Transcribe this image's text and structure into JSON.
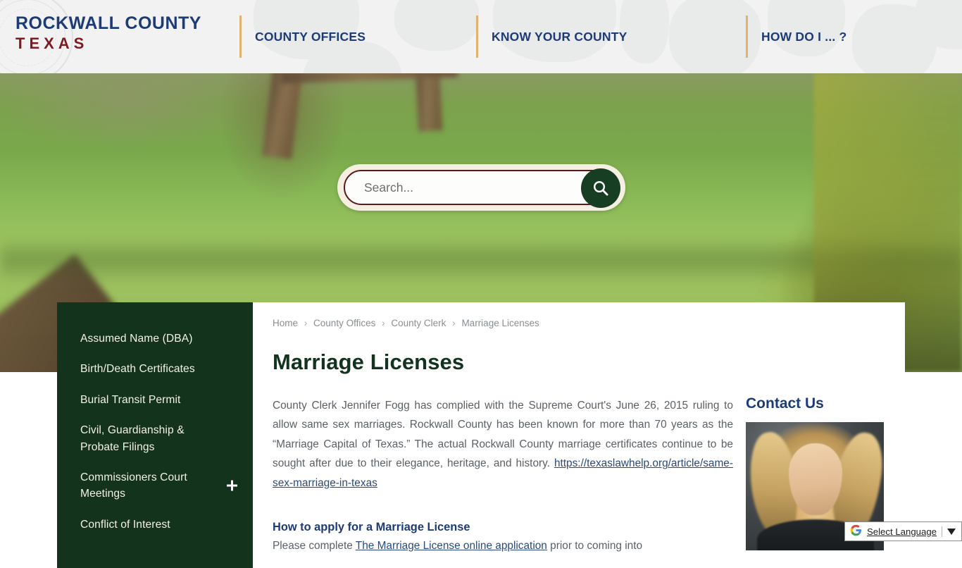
{
  "header": {
    "logo_line1": "ROCKWALL COUNTY",
    "logo_line2": "TEXAS",
    "nav": [
      {
        "label": "COUNTY OFFICES"
      },
      {
        "label": "KNOW YOUR COUNTY"
      },
      {
        "label": "HOW DO I ... ?"
      }
    ],
    "colors": {
      "logo_blue": "#1d3b77",
      "logo_maroon": "#7d1a24",
      "divider_gold": "#dfb472"
    }
  },
  "search": {
    "placeholder": "Search...",
    "value": "",
    "icon": "search-icon",
    "button_color": "#173d23",
    "border_color": "#5e1620"
  },
  "sidebar": {
    "background": "#14331d",
    "items": [
      {
        "label": "Assumed Name (DBA)",
        "expandable": false
      },
      {
        "label": "Birth/Death Certificates",
        "expandable": false
      },
      {
        "label": "Burial Transit Permit",
        "expandable": false
      },
      {
        "label": "Civil, Guardianship & Probate Filings",
        "expandable": false
      },
      {
        "label": "Commissioners Court Meetings",
        "expandable": true
      },
      {
        "label": "Conflict of Interest",
        "expandable": false
      }
    ]
  },
  "breadcrumb": {
    "items": [
      "Home",
      "County Offices",
      "County Clerk",
      "Marriage Licenses"
    ],
    "separator": "›"
  },
  "main": {
    "title": "Marriage Licenses",
    "intro_text": "County Clerk Jennifer Fogg has complied with the Supreme Court's June 26, 2015 ruling to allow same sex marriages. Rockwall County has been known for more than 70 years as the “Marriage Capital of Texas.” The actual Rockwall County marriage certificates continue to be sought after due to their elegance, heritage, and history. ",
    "intro_link": "https://texaslawhelp.org/article/same-sex-marriage-in-texas",
    "subheading": "How to apply for a Marriage License",
    "sub_text_before": "Please complete ",
    "sub_link": "The Marriage License online application",
    "sub_text_after": " prior to coming into"
  },
  "contact": {
    "title": "Contact Us",
    "photo_alt": "county-clerk-portrait"
  },
  "translate": {
    "google_g": "G",
    "label": "Select Language",
    "caret": "▼"
  }
}
